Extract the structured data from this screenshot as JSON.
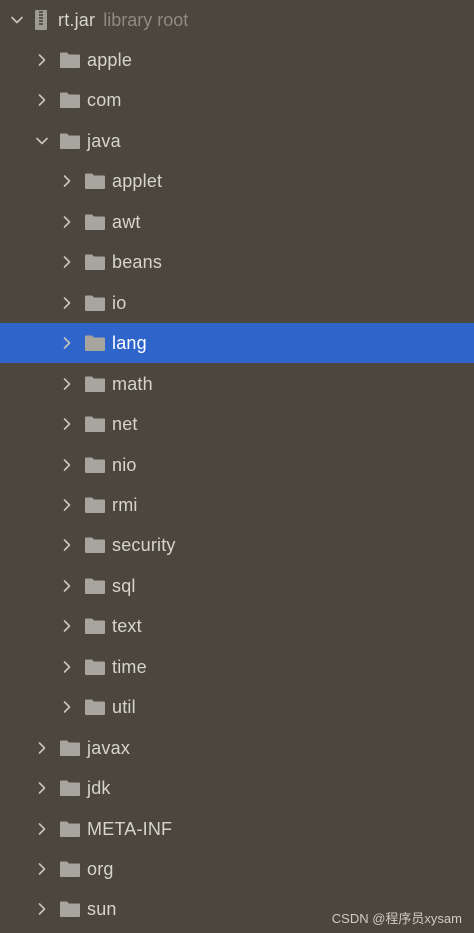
{
  "root": {
    "label": "rt.jar",
    "sublabel": "library root"
  },
  "nodes": [
    {
      "label": "apple",
      "expanded": false
    },
    {
      "label": "com",
      "expanded": false
    },
    {
      "label": "java",
      "expanded": true
    },
    {
      "label": "applet",
      "expanded": false
    },
    {
      "label": "awt",
      "expanded": false
    },
    {
      "label": "beans",
      "expanded": false
    },
    {
      "label": "io",
      "expanded": false
    },
    {
      "label": "lang",
      "expanded": false,
      "selected": true
    },
    {
      "label": "math",
      "expanded": false
    },
    {
      "label": "net",
      "expanded": false
    },
    {
      "label": "nio",
      "expanded": false
    },
    {
      "label": "rmi",
      "expanded": false
    },
    {
      "label": "security",
      "expanded": false
    },
    {
      "label": "sql",
      "expanded": false
    },
    {
      "label": "text",
      "expanded": false
    },
    {
      "label": "time",
      "expanded": false
    },
    {
      "label": "util",
      "expanded": false
    },
    {
      "label": "javax",
      "expanded": false
    },
    {
      "label": "jdk",
      "expanded": false
    },
    {
      "label": "META-INF",
      "expanded": false
    },
    {
      "label": "org",
      "expanded": false
    },
    {
      "label": "sun",
      "expanded": false
    }
  ],
  "watermark": "CSDN @程序员xysam",
  "colors": {
    "background": "#4b473f",
    "selection": "#2f65ca",
    "text": "#d7d4cd",
    "muted": "#8e8a82",
    "folder": "#a8a59e"
  }
}
